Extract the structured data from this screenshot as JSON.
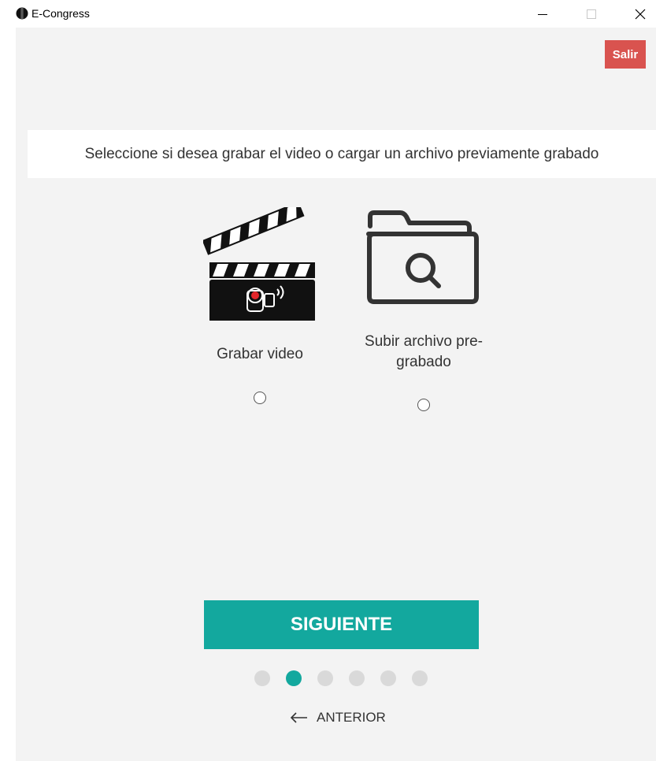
{
  "window": {
    "title": "E-Congress",
    "icons": {
      "app": "app-logo-icon",
      "minimize": "minimize-icon",
      "maximize": "maximize-icon",
      "close": "close-icon"
    }
  },
  "header": {
    "exit_label": "Salir",
    "exit_color": "#d9534f"
  },
  "instruction": "Seleccione si desea grabar el video o cargar un archivo previamente grabado",
  "options": [
    {
      "label": "Grabar video",
      "icon": "clapperboard-camera-icon",
      "selected": false
    },
    {
      "label": "Subir archivo pre-grabado",
      "label_line1": "Subir archivo pre-",
      "label_line2": "grabado",
      "icon": "folder-search-icon",
      "selected": false
    }
  ],
  "footer": {
    "next_label": "SIGUIENTE",
    "next_color": "#13a89e",
    "steps_total": 6,
    "current_step": 2,
    "back_label": "ANTERIOR",
    "back_icon": "arrow-left-icon"
  }
}
